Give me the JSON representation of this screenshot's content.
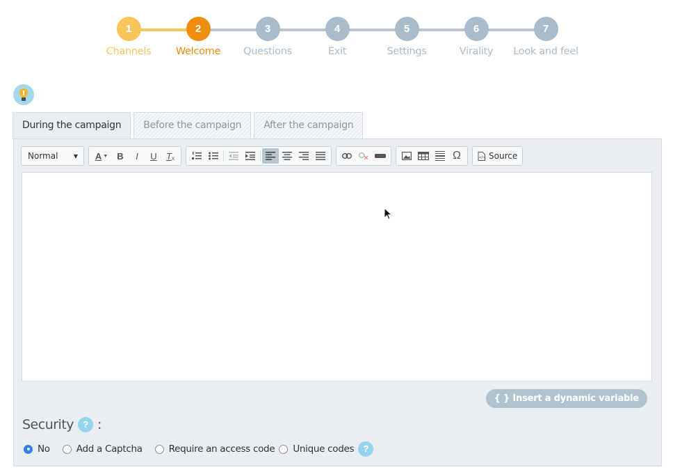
{
  "stepper": {
    "steps": [
      {
        "number": "1",
        "label": "Channels",
        "state": "done"
      },
      {
        "number": "2",
        "label": "Welcome",
        "state": "active"
      },
      {
        "number": "3",
        "label": "Questions",
        "state": "todo"
      },
      {
        "number": "4",
        "label": "Exit",
        "state": "todo"
      },
      {
        "number": "5",
        "label": "Settings",
        "state": "todo"
      },
      {
        "number": "6",
        "label": "Virality",
        "state": "todo"
      },
      {
        "number": "7",
        "label": "Look and feel",
        "state": "todo"
      }
    ]
  },
  "tabs": [
    {
      "label": "During the campaign",
      "active": true
    },
    {
      "label": "Before the campaign",
      "active": false
    },
    {
      "label": "After the campaign",
      "active": false
    }
  ],
  "toolbar": {
    "format_select": "Normal",
    "source_label": "Source",
    "buttons": {
      "bold": "B",
      "italic": "I",
      "underline": "U",
      "clear_format": "T",
      "font_color": "A",
      "special_char": "Ω"
    }
  },
  "editor": {
    "content": ""
  },
  "insert_variable_label": "{ } Insert a dynamic variable",
  "security": {
    "title": "Security",
    "help": "?",
    "colon": ":",
    "options": [
      {
        "label": "No",
        "checked": true
      },
      {
        "label": "Add a Captcha",
        "checked": false
      },
      {
        "label": "Require an access code",
        "checked": false
      },
      {
        "label": "Unique codes",
        "checked": false
      }
    ],
    "unique_help": "?"
  },
  "colors": {
    "step_done": "#f9c45a",
    "step_active": "#ef8d0c",
    "step_todo": "#a9bccb",
    "panel_bg": "#e8eef1",
    "radio_checked": "#2f80ed"
  }
}
